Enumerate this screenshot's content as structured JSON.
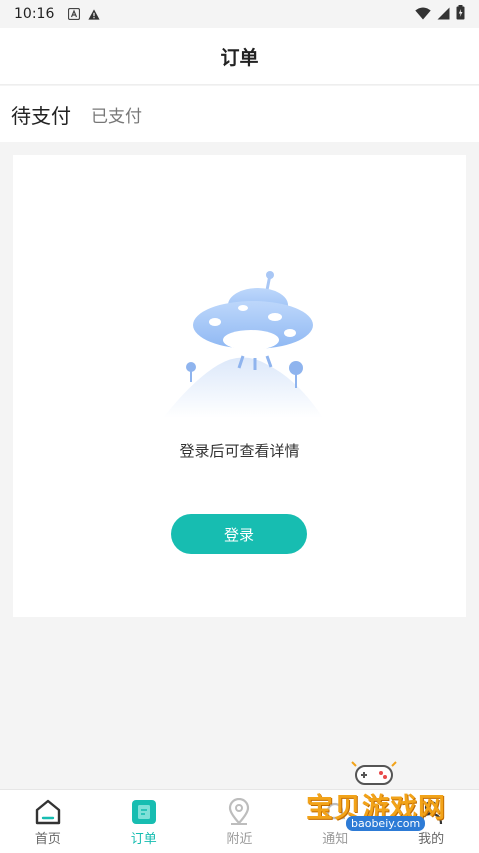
{
  "status_bar": {
    "time": "10:16"
  },
  "header": {
    "title": "订单"
  },
  "tabs": [
    {
      "label": "待支付",
      "active": true
    },
    {
      "label": "已支付",
      "active": false
    }
  ],
  "empty_state": {
    "message": "登录后可查看详情",
    "button_label": "登录"
  },
  "bottom_nav": [
    {
      "label": "首页",
      "icon": "home-icon",
      "active": false
    },
    {
      "label": "订单",
      "icon": "orders-icon",
      "active": true
    },
    {
      "label": "附近",
      "icon": "location-pin-icon",
      "active": false
    },
    {
      "label": "通知",
      "icon": "bell-icon",
      "active": false
    },
    {
      "label": "我的",
      "icon": "profile-icon",
      "active": false
    }
  ],
  "watermark": {
    "title": "宝贝游戏网",
    "url": "baobeiy.com"
  },
  "colors": {
    "accent": "#17bdb1",
    "background": "#f4f4f4"
  }
}
